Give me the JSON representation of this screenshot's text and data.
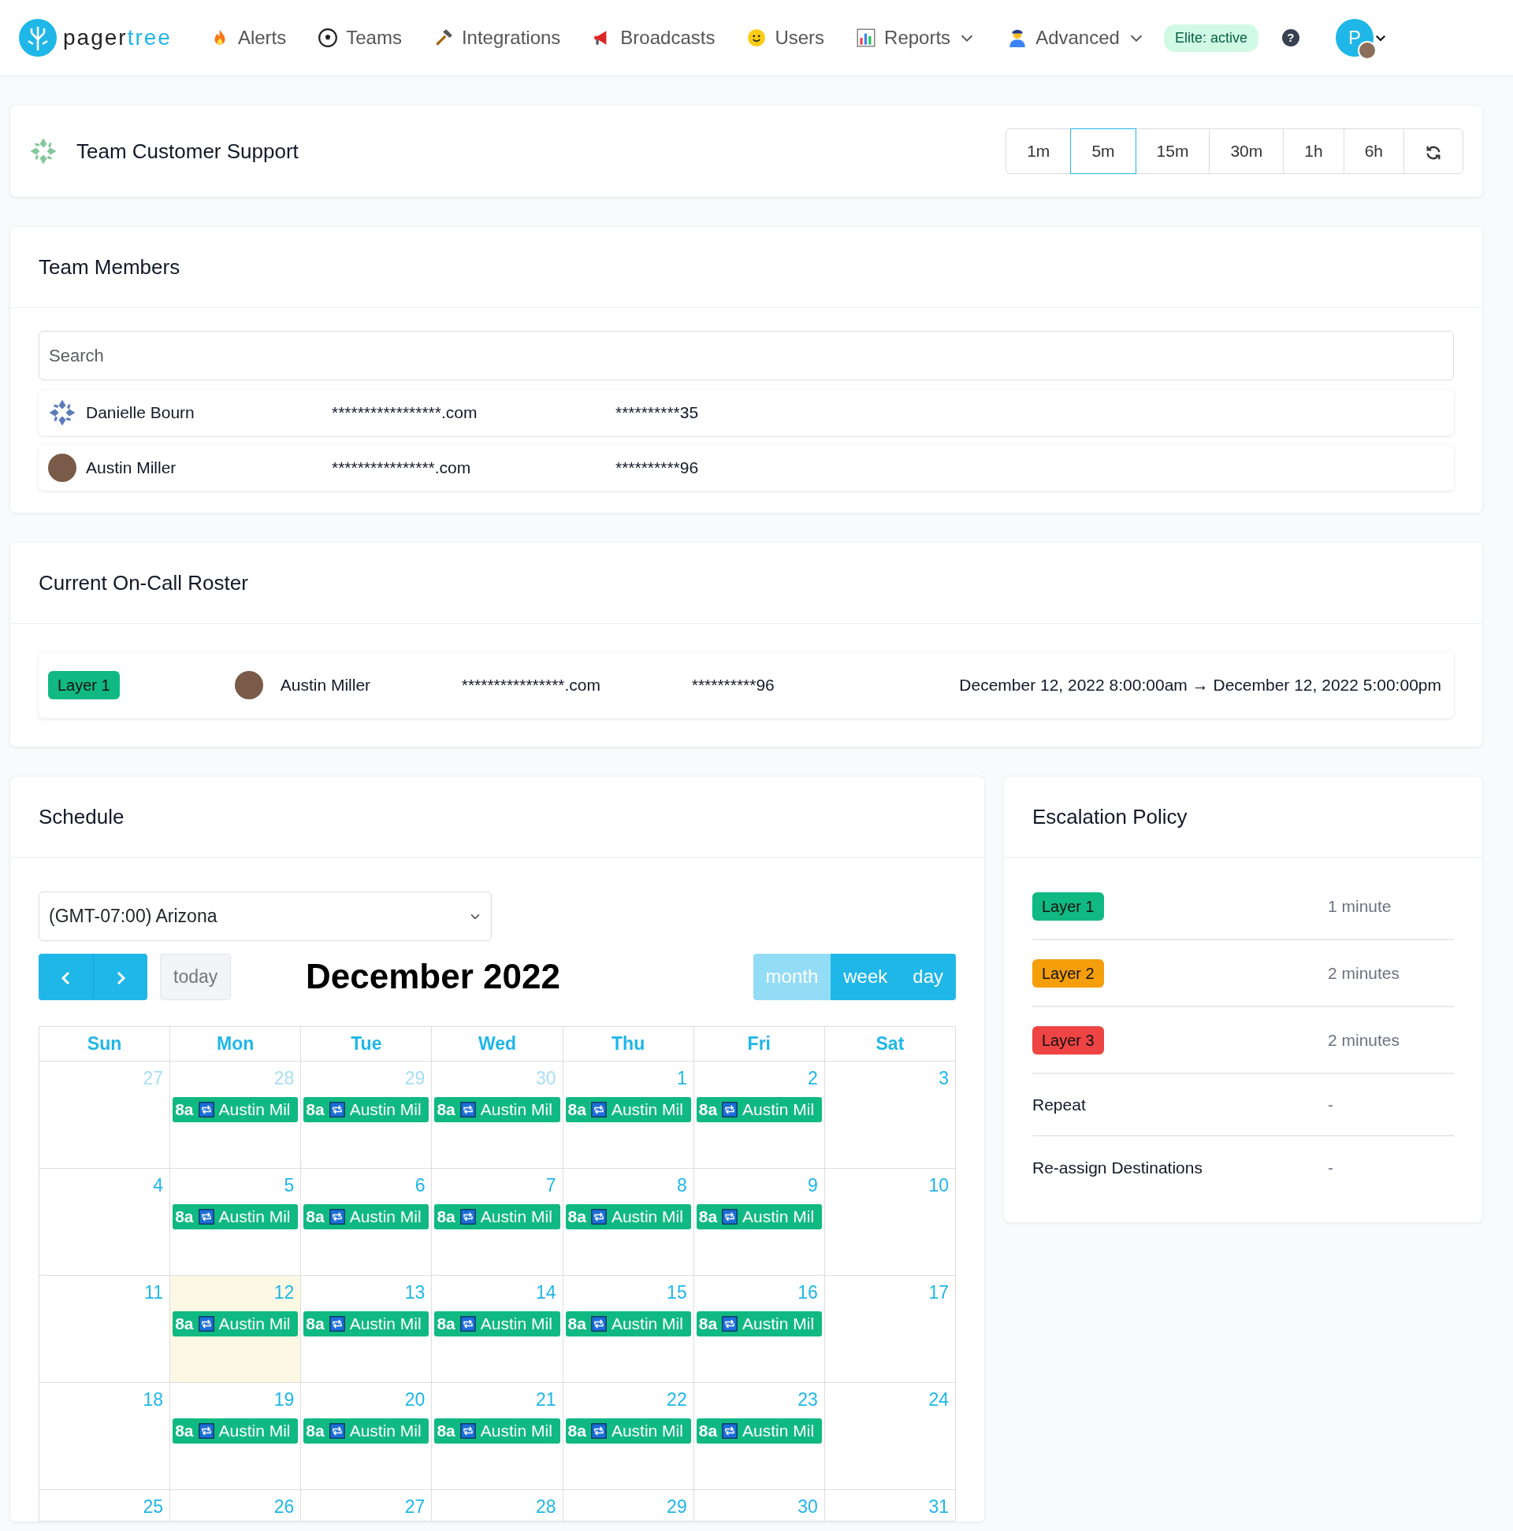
{
  "navbar": {
    "logo": {
      "first": "pager",
      "second": "tree"
    },
    "items": [
      {
        "label": "Alerts",
        "dropdown": false
      },
      {
        "label": "Teams",
        "dropdown": false
      },
      {
        "label": "Integrations",
        "dropdown": false
      },
      {
        "label": "Broadcasts",
        "dropdown": false
      },
      {
        "label": "Users",
        "dropdown": false
      },
      {
        "label": "Reports",
        "dropdown": true
      },
      {
        "label": "Advanced",
        "dropdown": true
      }
    ],
    "plan_badge": "Elite: active",
    "help": "?",
    "avatar_letter": "P"
  },
  "team_header": {
    "title": "Team Customer Support",
    "intervals": [
      {
        "label": "1m",
        "selected": false
      },
      {
        "label": "5m",
        "selected": true
      },
      {
        "label": "15m",
        "selected": false
      },
      {
        "label": "30m",
        "selected": false
      },
      {
        "label": "1h",
        "selected": false
      },
      {
        "label": "6h",
        "selected": false
      }
    ]
  },
  "team_members": {
    "title": "Team Members",
    "search": {
      "placeholder": "Search"
    },
    "members": [
      {
        "kind": "pattern",
        "name": "Danielle Bourn",
        "email": "*****************.com",
        "phone": "**********35"
      },
      {
        "kind": "photo",
        "name": "Austin Miller",
        "email": "****************.com",
        "phone": "**********96"
      }
    ]
  },
  "roster": {
    "title": "Current On-Call Roster",
    "rows": [
      {
        "layer": "Layer 1",
        "color": "#10b981",
        "name": "Austin Miller",
        "email": "****************.com",
        "phone": "**********96",
        "shift": "December 12, 2022 8:00:00am → December 12, 2022 5:00:00pm"
      }
    ]
  },
  "schedule": {
    "title": "Schedule",
    "timezone": "(GMT-07:00) Arizona",
    "today_button": "today",
    "month_title": "December 2022",
    "views": [
      {
        "label": "month",
        "selected": true
      },
      {
        "label": "week",
        "selected": false
      },
      {
        "label": "day",
        "selected": false
      }
    ],
    "weekdays": [
      "Sun",
      "Mon",
      "Tue",
      "Wed",
      "Thu",
      "Fri",
      "Sat"
    ],
    "weeks": [
      [
        {
          "day": "27",
          "other_month": true,
          "today": false
        },
        {
          "day": "28",
          "other_month": true,
          "today": false,
          "events": [
            {
              "time": "8a",
              "title": "Austin Mil"
            }
          ]
        },
        {
          "day": "29",
          "other_month": true,
          "today": false,
          "events": [
            {
              "time": "8a",
              "title": "Austin Mil"
            }
          ]
        },
        {
          "day": "30",
          "other_month": true,
          "today": false,
          "events": [
            {
              "time": "8a",
              "title": "Austin Mil"
            }
          ]
        },
        {
          "day": "1",
          "other_month": false,
          "today": false,
          "events": [
            {
              "time": "8a",
              "title": "Austin Mil"
            }
          ]
        },
        {
          "day": "2",
          "other_month": false,
          "today": false,
          "events": [
            {
              "time": "8a",
              "title": "Austin Mil"
            }
          ]
        },
        {
          "day": "3",
          "other_month": false,
          "today": false
        }
      ],
      [
        {
          "day": "4",
          "other_month": false,
          "today": false
        },
        {
          "day": "5",
          "other_month": false,
          "today": false,
          "events": [
            {
              "time": "8a",
              "title": "Austin Mil"
            }
          ]
        },
        {
          "day": "6",
          "other_month": false,
          "today": false,
          "events": [
            {
              "time": "8a",
              "title": "Austin Mil"
            }
          ]
        },
        {
          "day": "7",
          "other_month": false,
          "today": false,
          "events": [
            {
              "time": "8a",
              "title": "Austin Mil"
            }
          ]
        },
        {
          "day": "8",
          "other_month": false,
          "today": false,
          "events": [
            {
              "time": "8a",
              "title": "Austin Mil"
            }
          ]
        },
        {
          "day": "9",
          "other_month": false,
          "today": false,
          "events": [
            {
              "time": "8a",
              "title": "Austin Mil"
            }
          ]
        },
        {
          "day": "10",
          "other_month": false,
          "today": false
        }
      ],
      [
        {
          "day": "11",
          "other_month": false,
          "today": false
        },
        {
          "day": "12",
          "other_month": false,
          "today": true,
          "events": [
            {
              "time": "8a",
              "title": "Austin Mil"
            }
          ]
        },
        {
          "day": "13",
          "other_month": false,
          "today": false,
          "events": [
            {
              "time": "8a",
              "title": "Austin Mil"
            }
          ]
        },
        {
          "day": "14",
          "other_month": false,
          "today": false,
          "events": [
            {
              "time": "8a",
              "title": "Austin Mil"
            }
          ]
        },
        {
          "day": "15",
          "other_month": false,
          "today": false,
          "events": [
            {
              "time": "8a",
              "title": "Austin Mil"
            }
          ]
        },
        {
          "day": "16",
          "other_month": false,
          "today": false,
          "events": [
            {
              "time": "8a",
              "title": "Austin Mil"
            }
          ]
        },
        {
          "day": "17",
          "other_month": false,
          "today": false
        }
      ],
      [
        {
          "day": "18",
          "other_month": false,
          "today": false
        },
        {
          "day": "19",
          "other_month": false,
          "today": false,
          "events": [
            {
              "time": "8a",
              "title": "Austin Mil"
            }
          ]
        },
        {
          "day": "20",
          "other_month": false,
          "today": false,
          "events": [
            {
              "time": "8a",
              "title": "Austin Mil"
            }
          ]
        },
        {
          "day": "21",
          "other_month": false,
          "today": false,
          "events": [
            {
              "time": "8a",
              "title": "Austin Mil"
            }
          ]
        },
        {
          "day": "22",
          "other_month": false,
          "today": false,
          "events": [
            {
              "time": "8a",
              "title": "Austin Mil"
            }
          ]
        },
        {
          "day": "23",
          "other_month": false,
          "today": false,
          "events": [
            {
              "time": "8a",
              "title": "Austin Mil"
            }
          ]
        },
        {
          "day": "24",
          "other_month": false,
          "today": false
        }
      ],
      [
        {
          "day": "25",
          "other_month": false,
          "today": false
        },
        {
          "day": "26",
          "other_month": false,
          "today": false
        },
        {
          "day": "27",
          "other_month": false,
          "today": false
        },
        {
          "day": "28",
          "other_month": false,
          "today": false
        },
        {
          "day": "29",
          "other_month": false,
          "today": false
        },
        {
          "day": "30",
          "other_month": false,
          "today": false
        },
        {
          "day": "31",
          "other_month": false,
          "today": false
        }
      ]
    ]
  },
  "escalation": {
    "title": "Escalation Policy",
    "layers": [
      {
        "label": "Layer 1",
        "color": "#10b981",
        "delay": "1 minute"
      },
      {
        "label": "Layer 2",
        "color": "#f59e0b",
        "delay": "2 minutes"
      },
      {
        "label": "Layer 3",
        "color": "#ef4444",
        "delay": "2 minutes"
      }
    ],
    "rows": [
      {
        "label": "Repeat",
        "value": "-"
      },
      {
        "label": "Re-assign Destinations",
        "value": "-"
      }
    ]
  }
}
